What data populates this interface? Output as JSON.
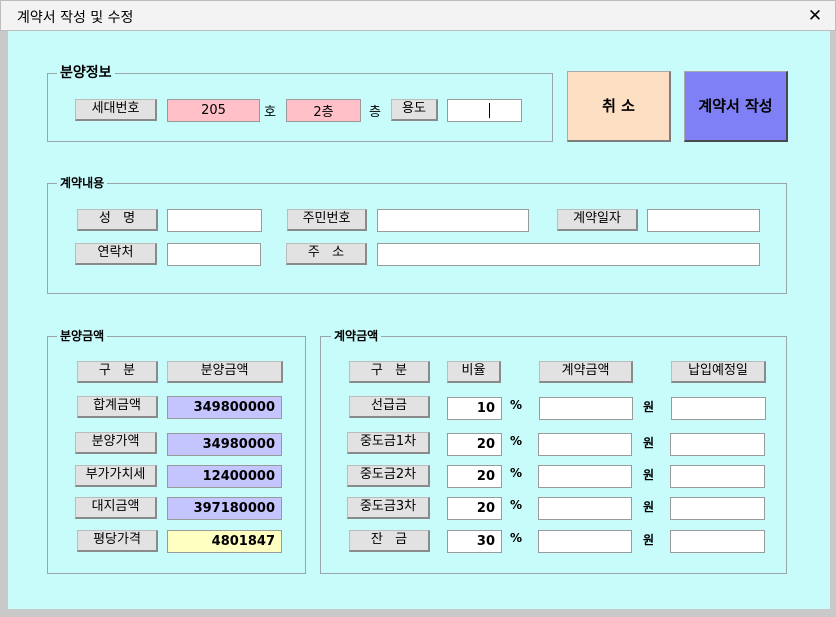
{
  "window": {
    "title": "계약서 작성 및 수정",
    "close_glyph": "✕"
  },
  "sale_info": {
    "legend": "분양정보",
    "unit_label": "세대번호",
    "unit_value": "205",
    "unit_suffix": "호",
    "floor_value": "2층",
    "floor_suffix": "층",
    "usage_label": "용도",
    "usage_value": ""
  },
  "buttons": {
    "cancel": "취 소",
    "write_contract": "계약서 작성"
  },
  "contract_info": {
    "legend": "계약내용",
    "name_label": "성   명",
    "name_value": "",
    "id_label": "주민번호",
    "id_value": "",
    "date_label": "계약일자",
    "date_value": "",
    "contact_label": "연락처",
    "contact_value": "",
    "address_label": "주   소",
    "address_value": ""
  },
  "sale_amount": {
    "legend": "분양금액",
    "col_category": "구   분",
    "col_amount": "분양금액",
    "rows": [
      {
        "label": "합계금액",
        "value": "349800000"
      },
      {
        "label": "분양가액",
        "value": "34980000"
      },
      {
        "label": "부가가치세",
        "value": "12400000"
      },
      {
        "label": "대지금액",
        "value": "397180000"
      },
      {
        "label": "평당가격",
        "value": "4801847"
      }
    ]
  },
  "contract_amount": {
    "legend": "계약금액",
    "col_category": "구   분",
    "col_ratio": "비율",
    "col_amount": "계약금액",
    "col_due": "납입예정일",
    "percent": "%",
    "won": "원",
    "rows": [
      {
        "label": "선급금",
        "ratio": "10",
        "amount": "",
        "due": ""
      },
      {
        "label": "중도금1차",
        "ratio": "20",
        "amount": "",
        "due": ""
      },
      {
        "label": "중도금2차",
        "ratio": "20",
        "amount": "",
        "due": ""
      },
      {
        "label": "중도금3차",
        "ratio": "20",
        "amount": "",
        "due": ""
      },
      {
        "label": "잔   금",
        "ratio": "30",
        "amount": "",
        "due": ""
      }
    ]
  },
  "colors": {
    "background": "#c7fcfb",
    "pink_field": "#ffc0c8",
    "lavender_field": "#c4c4ff",
    "yellow_field": "#ffffc2",
    "cancel_button": "#fde0c4",
    "write_button": "#7f7ff6"
  },
  "icons": {
    "close": "close-icon"
  }
}
